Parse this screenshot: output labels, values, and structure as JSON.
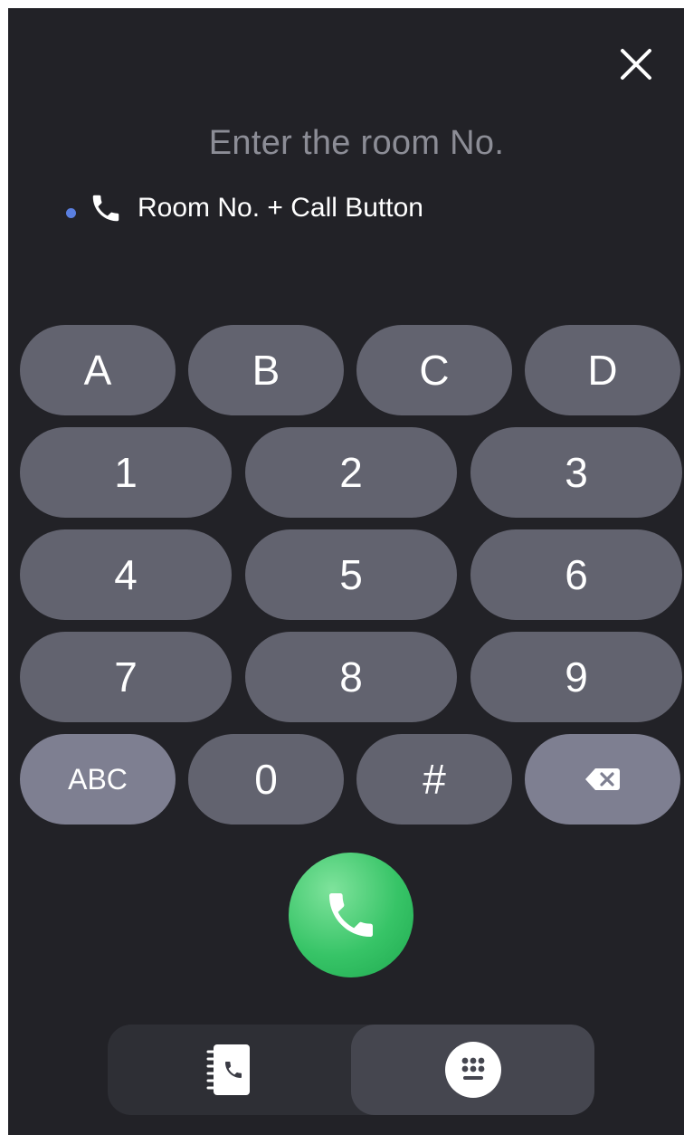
{
  "header": {
    "close_icon": "close-icon",
    "prompt": "Enter the room No."
  },
  "hint": {
    "dot_color": "#5a7fe0",
    "icon": "phone-icon",
    "text": "Room No. + Call Button"
  },
  "keypad": {
    "row1": [
      "A",
      "B",
      "C",
      "D"
    ],
    "row2": [
      "1",
      "2",
      "3"
    ],
    "row3": [
      "4",
      "5",
      "6"
    ],
    "row4": [
      "7",
      "8",
      "9"
    ],
    "row5": {
      "abc": "ABC",
      "zero": "0",
      "hash": "#",
      "backspace_icon": "backspace-icon"
    }
  },
  "call_button": {
    "icon": "phone-icon",
    "color": "#37c467"
  },
  "tabs": [
    {
      "name": "contacts",
      "icon": "contact-book-icon",
      "active": false
    },
    {
      "name": "dialpad",
      "icon": "dialpad-icon",
      "active": true
    }
  ]
}
